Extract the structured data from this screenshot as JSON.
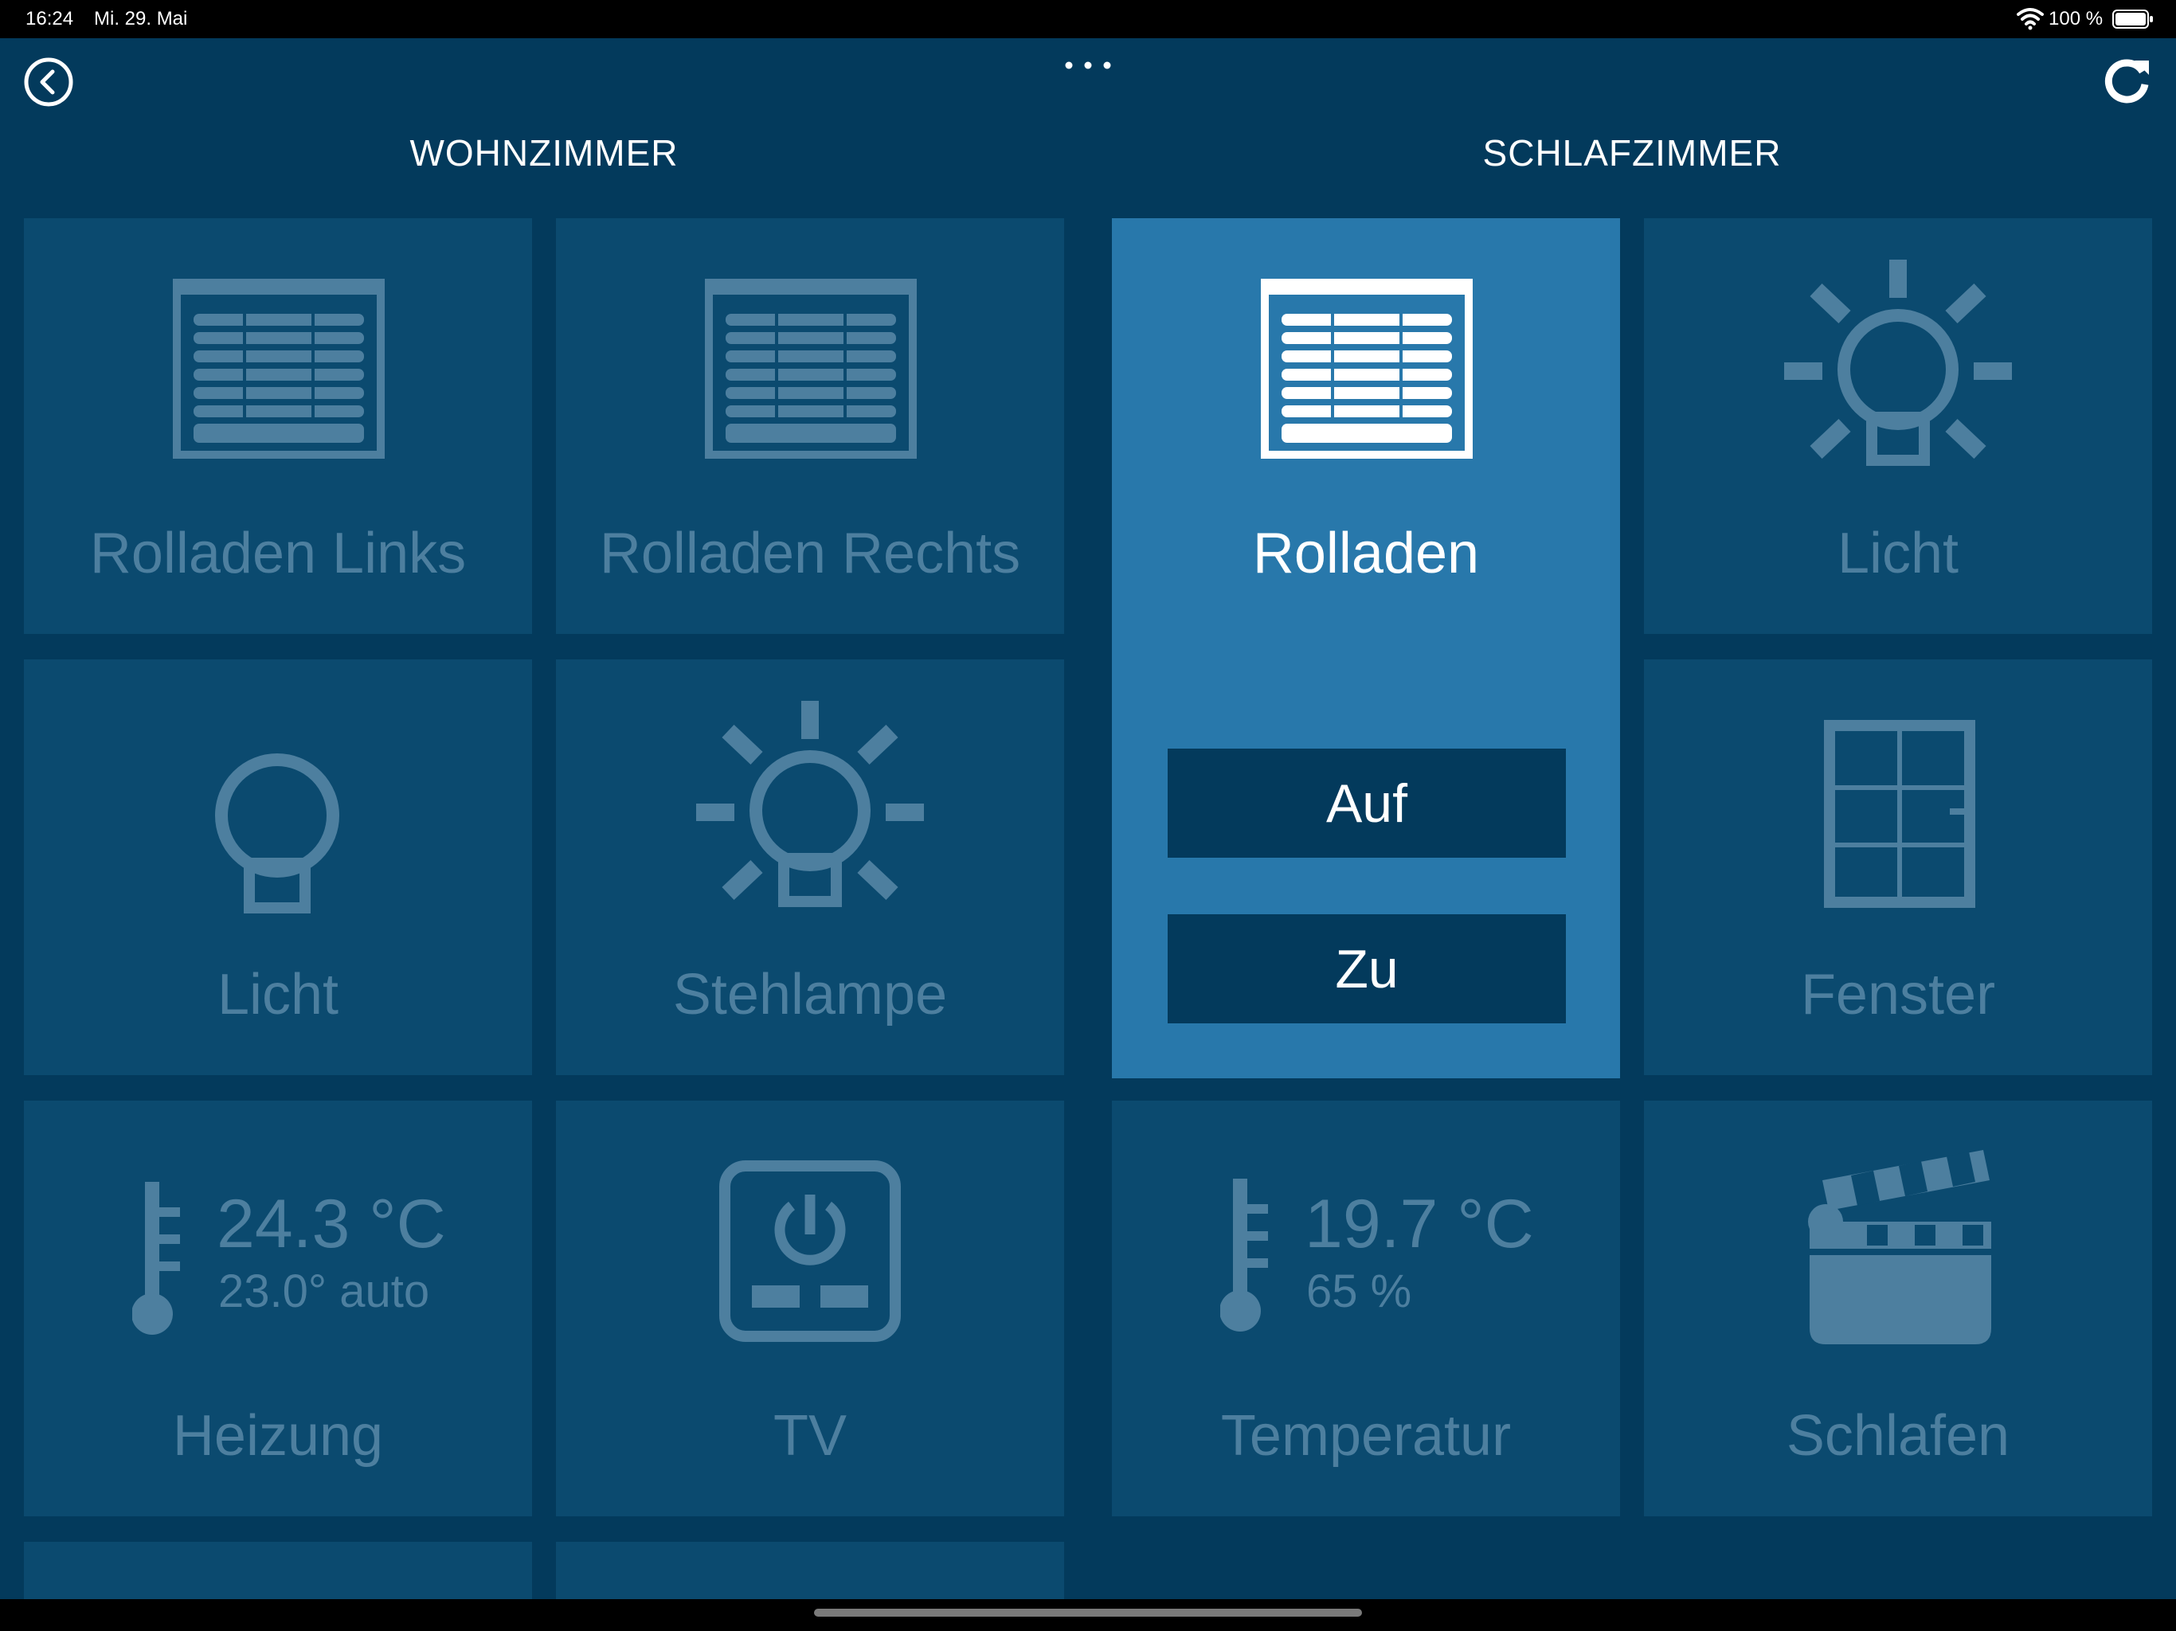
{
  "status_bar": {
    "time": "16:24",
    "date": "Mi. 29. Mai",
    "battery_text": "100 %",
    "wifi_icon": "wifi-icon",
    "battery_icon": "battery-full-icon"
  },
  "navbar": {
    "back_icon": "back-circle-icon",
    "more_label": "···",
    "refresh_icon": "refresh-icon"
  },
  "rooms": {
    "left": {
      "title": "WOHNZIMMER"
    },
    "right": {
      "title": "SCHLAFZIMMER"
    }
  },
  "tiles": {
    "rolladen_links": {
      "label": "Rolladen Links",
      "icon": "shutter-icon"
    },
    "rolladen_rechts": {
      "label": "Rolladen Rechts",
      "icon": "shutter-icon"
    },
    "rolladen": {
      "label": "Rolladen",
      "icon": "shutter-icon",
      "up_label": "Auf",
      "down_label": "Zu"
    },
    "licht_schlaf": {
      "label": "Licht",
      "icon": "light-on-icon"
    },
    "licht_wohn": {
      "label": "Licht",
      "icon": "bulb-icon"
    },
    "stehlampe": {
      "label": "Stehlampe",
      "icon": "light-on-icon"
    },
    "fenster": {
      "label": "Fenster",
      "icon": "window-icon"
    },
    "heizung": {
      "label": "Heizung",
      "icon": "thermometer-icon",
      "temperature": "24.3 °C",
      "setpoint": "23.0° auto"
    },
    "tv": {
      "label": "TV",
      "icon": "power-socket-icon"
    },
    "temperatur": {
      "label": "Temperatur",
      "icon": "thermometer-icon",
      "temperature": "19.7 °C",
      "humidity": "65 %"
    },
    "schlafen": {
      "label": "Schlafen",
      "icon": "clapperboard-icon"
    }
  },
  "colors": {
    "background": "#033a5c",
    "tile": "#0b4a6f",
    "tile_active": "#2878ab",
    "tile_muted_text": "#4d7f9f",
    "button": "#033a5c"
  }
}
